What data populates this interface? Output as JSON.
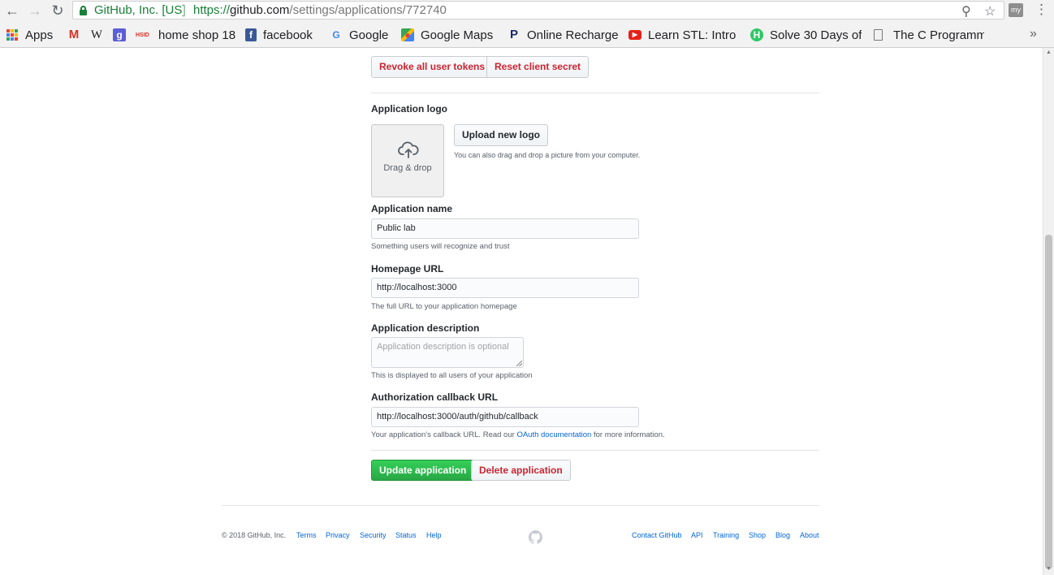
{
  "browser": {
    "site_identity": "GitHub, Inc. [US]",
    "url_scheme": "https://",
    "url_host": "github.com",
    "url_path": "/settings/applications/772740",
    "extension_badge": "my",
    "bookmarks": [
      {
        "label": "Apps",
        "icon": "apps-grid-icon"
      },
      {
        "label": "",
        "icon": "gmail-icon"
      },
      {
        "label": "",
        "icon": "wikipedia-icon"
      },
      {
        "label": "",
        "icon": "google-plus-icon"
      },
      {
        "label": "",
        "icon": "hsid-icon"
      },
      {
        "label": "home shop 18"
      },
      {
        "label": "facebook",
        "icon": "facebook-icon"
      },
      {
        "label": "Google",
        "icon": "google-icon"
      },
      {
        "label": "Google Maps",
        "icon": "google-maps-icon"
      },
      {
        "label": "Online Recharge",
        "icon": "paytm-icon"
      },
      {
        "label": "Learn STL: Intro",
        "icon": "youtube-icon"
      },
      {
        "label": "Solve 30 Days of",
        "icon": "hackerrank-icon"
      },
      {
        "label": "The C Programming",
        "icon": "document-icon"
      }
    ]
  },
  "app_settings": {
    "revoke_tokens_label": "Revoke all user tokens",
    "reset_secret_label": "Reset client secret",
    "logo_label": "Application logo",
    "drop_text": "Drag & drop",
    "upload_logo_label": "Upload new logo",
    "upload_hint": "You can also drag and drop a picture from your computer.",
    "name_label": "Application name",
    "name_value": "Public lab",
    "name_hint": "Something users will recognize and trust",
    "homepage_label": "Homepage URL",
    "homepage_value": "http://localhost:3000",
    "homepage_hint": "The full URL to your application homepage",
    "description_label": "Application description",
    "description_placeholder": "Application description is optional",
    "description_hint": "This is displayed to all users of your application",
    "callback_label": "Authorization callback URL",
    "callback_value": "http://localhost:3000/auth/github/callback",
    "callback_hint_prefix": "Your application's callback URL. Read our",
    "callback_hint_link": "OAuth documentation",
    "callback_hint_suffix": "for more information.",
    "update_label": "Update application",
    "delete_label": "Delete application"
  },
  "footer": {
    "copyright": "© 2018 GitHub, Inc.",
    "left_links": [
      "Terms",
      "Privacy",
      "Security",
      "Status",
      "Help"
    ],
    "right_links": [
      "Contact GitHub",
      "API",
      "Training",
      "Shop",
      "Blog",
      "About"
    ]
  },
  "colors": {
    "danger": "#cb2431",
    "primary": "#28a745",
    "link": "#0366d6",
    "secure": "#188038"
  }
}
